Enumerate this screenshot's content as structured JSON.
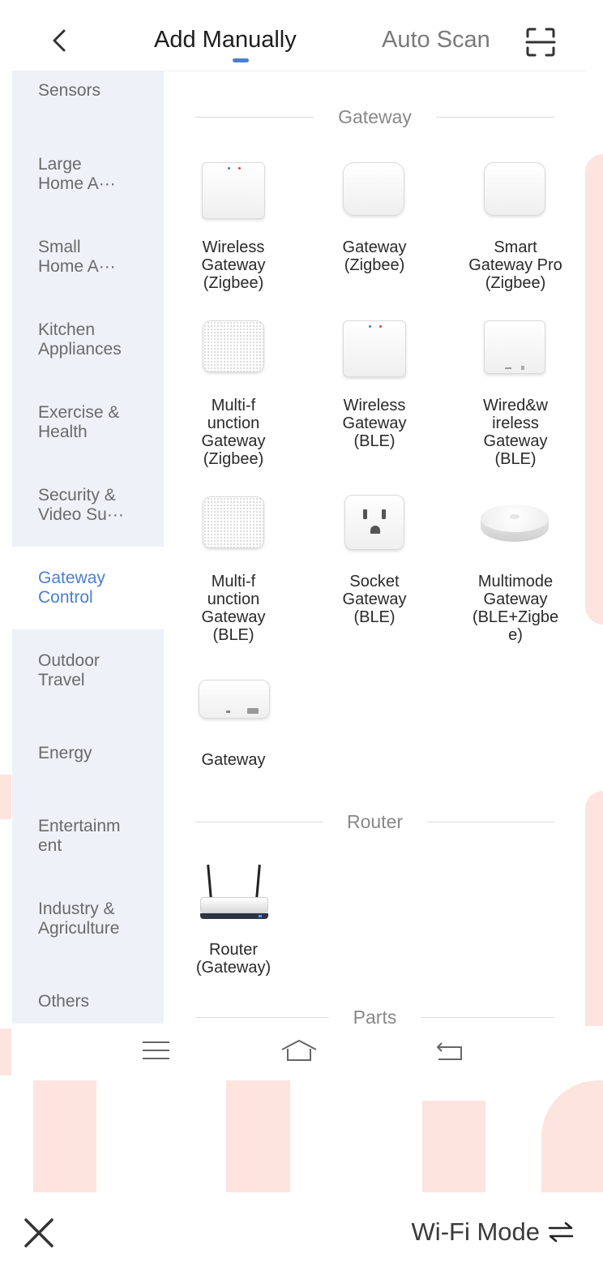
{
  "header": {
    "tab_add_manually": "Add Manually",
    "tab_auto_scan": "Auto Scan",
    "accent_color": "#4a7fd0"
  },
  "sidebar": {
    "items": [
      {
        "label": "Sensors"
      },
      {
        "label": "Large\nHome A···"
      },
      {
        "label": "Small\nHome A···"
      },
      {
        "label": "Kitchen\nAppliances"
      },
      {
        "label": "Exercise &\nHealth"
      },
      {
        "label": "Security &\nVideo Su···"
      },
      {
        "label": "Gateway\nControl"
      },
      {
        "label": "Outdoor\nTravel"
      },
      {
        "label": "Energy"
      },
      {
        "label": "Entertainm\nent"
      },
      {
        "label": "Industry &\nAgriculture"
      },
      {
        "label": "Others"
      }
    ],
    "selected": "Gateway Control"
  },
  "sections": {
    "gateway": {
      "title": "Gateway",
      "devices": [
        {
          "label": "Wireless\nGateway\n(Zigbee)",
          "icon": "white-hub-with-dots"
        },
        {
          "label": "Gateway\n(Zigbee)",
          "icon": "rounded-white-hub"
        },
        {
          "label": "Smart\nGateway Pro\n(Zigbee)",
          "icon": "rounded-white-hub"
        },
        {
          "label": "Multi-f\nunction\nGateway\n(Zigbee)",
          "icon": "speaker-mesh-hub"
        },
        {
          "label": "Wireless\nGateway\n(BLE)",
          "icon": "white-hub-with-dots"
        },
        {
          "label": "Wired&w\nireless\nGateway\n(BLE)",
          "icon": "flat-white-hub"
        },
        {
          "label": "Multi-f\nunction\nGateway\n(BLE)",
          "icon": "speaker-mesh-hub"
        },
        {
          "label": "Socket\nGateway\n(BLE)",
          "icon": "wall-socket"
        },
        {
          "label": "Multimode\nGateway\n(BLE+Zigbe\ne)",
          "icon": "round-puck-hub"
        },
        {
          "label": "Gateway",
          "icon": "wide-flat-hub"
        }
      ]
    },
    "router": {
      "title": "Router",
      "devices": [
        {
          "label": "Router\n(Gateway)",
          "icon": "router-with-antennas"
        }
      ]
    },
    "parts": {
      "title": "Parts"
    }
  },
  "footer": {
    "wifi_mode_label": "Wi-Fi Mode"
  }
}
